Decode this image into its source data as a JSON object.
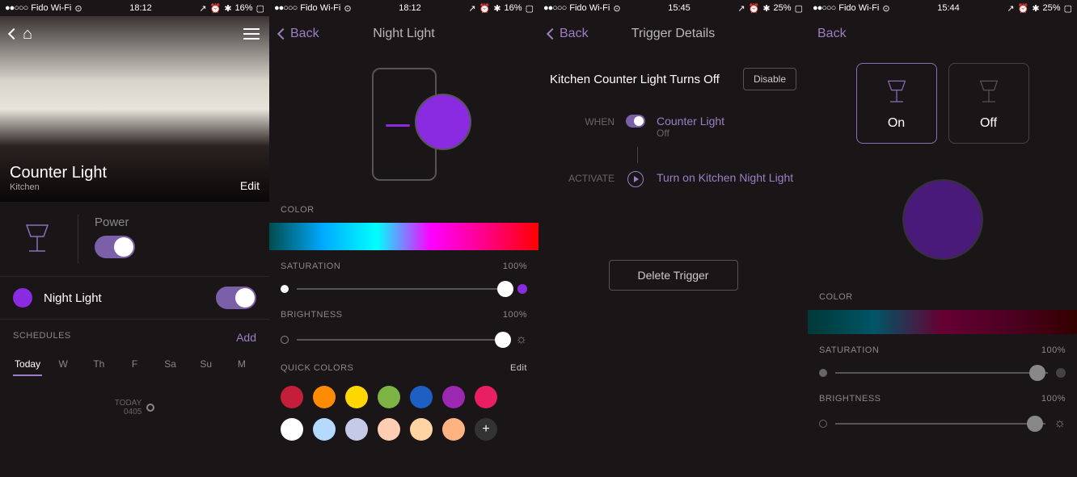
{
  "status": {
    "carrier": "Fido Wi-Fi",
    "time1": "18:12",
    "time2": "15:45",
    "time3": "15:44",
    "battery1": "16%",
    "battery2": "25%"
  },
  "s1": {
    "title": "Counter Light",
    "subtitle": "Kitchen",
    "edit": "Edit",
    "power_label": "Power",
    "preset_name": "Night Light",
    "schedules_label": "SCHEDULES",
    "schedules_add": "Add",
    "days": [
      "Today",
      "W",
      "Th",
      "F",
      "Sa",
      "Su",
      "M"
    ],
    "today_label": "TODAY",
    "today_time": "0405"
  },
  "s2": {
    "back": "Back",
    "title": "Night Light",
    "color_label": "COLOR",
    "sat_label": "SATURATION",
    "sat_value": "100%",
    "bright_label": "BRIGHTNESS",
    "bright_value": "100%",
    "quick_label": "QUICK COLORS",
    "quick_edit": "Edit",
    "quick_colors": [
      "#c41e3a",
      "#ff8c00",
      "#ffd700",
      "#7cb342",
      "#1e5fc4",
      "#9c27b0",
      "#e91e63",
      "#ffffff",
      "#b3d9ff",
      "#c5cae9",
      "#ffcdb2",
      "#ffd4a3",
      "#ffb380"
    ]
  },
  "s3": {
    "back": "Back",
    "title": "Trigger Details",
    "trigger_name": "Kitchen Counter Light Turns Off",
    "disable": "Disable",
    "when_label": "WHEN",
    "when_device": "Counter Light",
    "when_state": "Off",
    "activate_label": "ACTIVATE",
    "activate_action": "Turn on Kitchen Night Light",
    "delete": "Delete Trigger"
  },
  "s4": {
    "back": "Back",
    "on": "On",
    "off": "Off",
    "color_label": "COLOR",
    "sat_label": "SATURATION",
    "sat_value": "100%",
    "bright_label": "BRIGHTNESS",
    "bright_value": "100%"
  }
}
